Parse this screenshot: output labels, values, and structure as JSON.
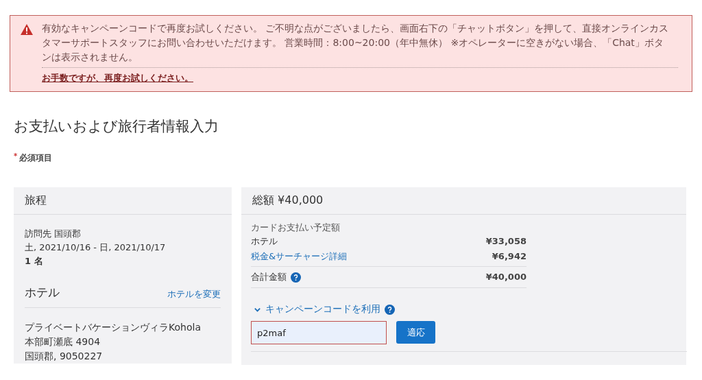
{
  "alert": {
    "message": "有効なキャンペーンコードで再度お試しください。 ご不明な点がございましたら、画面右下の「チャットボタン」を押して、直接オンラインカスタマーサポートスタッフにお問い合わせいただけます。 営業時間：8:00~20:00（年中無休） ※オペレーターに空きがない場合、「Chat」ボタンは表示されません。",
    "retry_link": "お手数ですが、再度お試しください。"
  },
  "page_title": "お支払いおよび旅行者情報入力",
  "required_note": {
    "mark": "*",
    "label": "必須項目"
  },
  "itinerary": {
    "title": "旅程",
    "lines": [
      {
        "text": "訪問先 国頭郡",
        "bold": false
      },
      {
        "text": "土, 2021/10/16 - 日, 2021/10/17",
        "bold": false
      },
      {
        "text": "1 名",
        "bold": true
      }
    ],
    "hotel": {
      "title": "ホテル",
      "change_link": "ホテルを変更",
      "address": [
        "プライベートバケーションヴィラKohola",
        "本部町瀬底 4904",
        "国頭郡, 9050227"
      ]
    }
  },
  "summary": {
    "title": "総額 ¥40,000",
    "subtitle": "カードお支払い予定額",
    "rows": [
      {
        "label": "ホテル",
        "amount": "¥33,058",
        "kind": "plain"
      },
      {
        "label": "税金&サーチャージ詳細",
        "amount": "¥6,942",
        "kind": "link"
      },
      {
        "label": "合計金額",
        "amount": "¥40,000",
        "kind": "total"
      }
    ],
    "campaign": {
      "label": "キャンペーンコードを利用",
      "expanded": true,
      "value": "p2maf",
      "invalid": true,
      "apply_button": "適応"
    }
  }
}
